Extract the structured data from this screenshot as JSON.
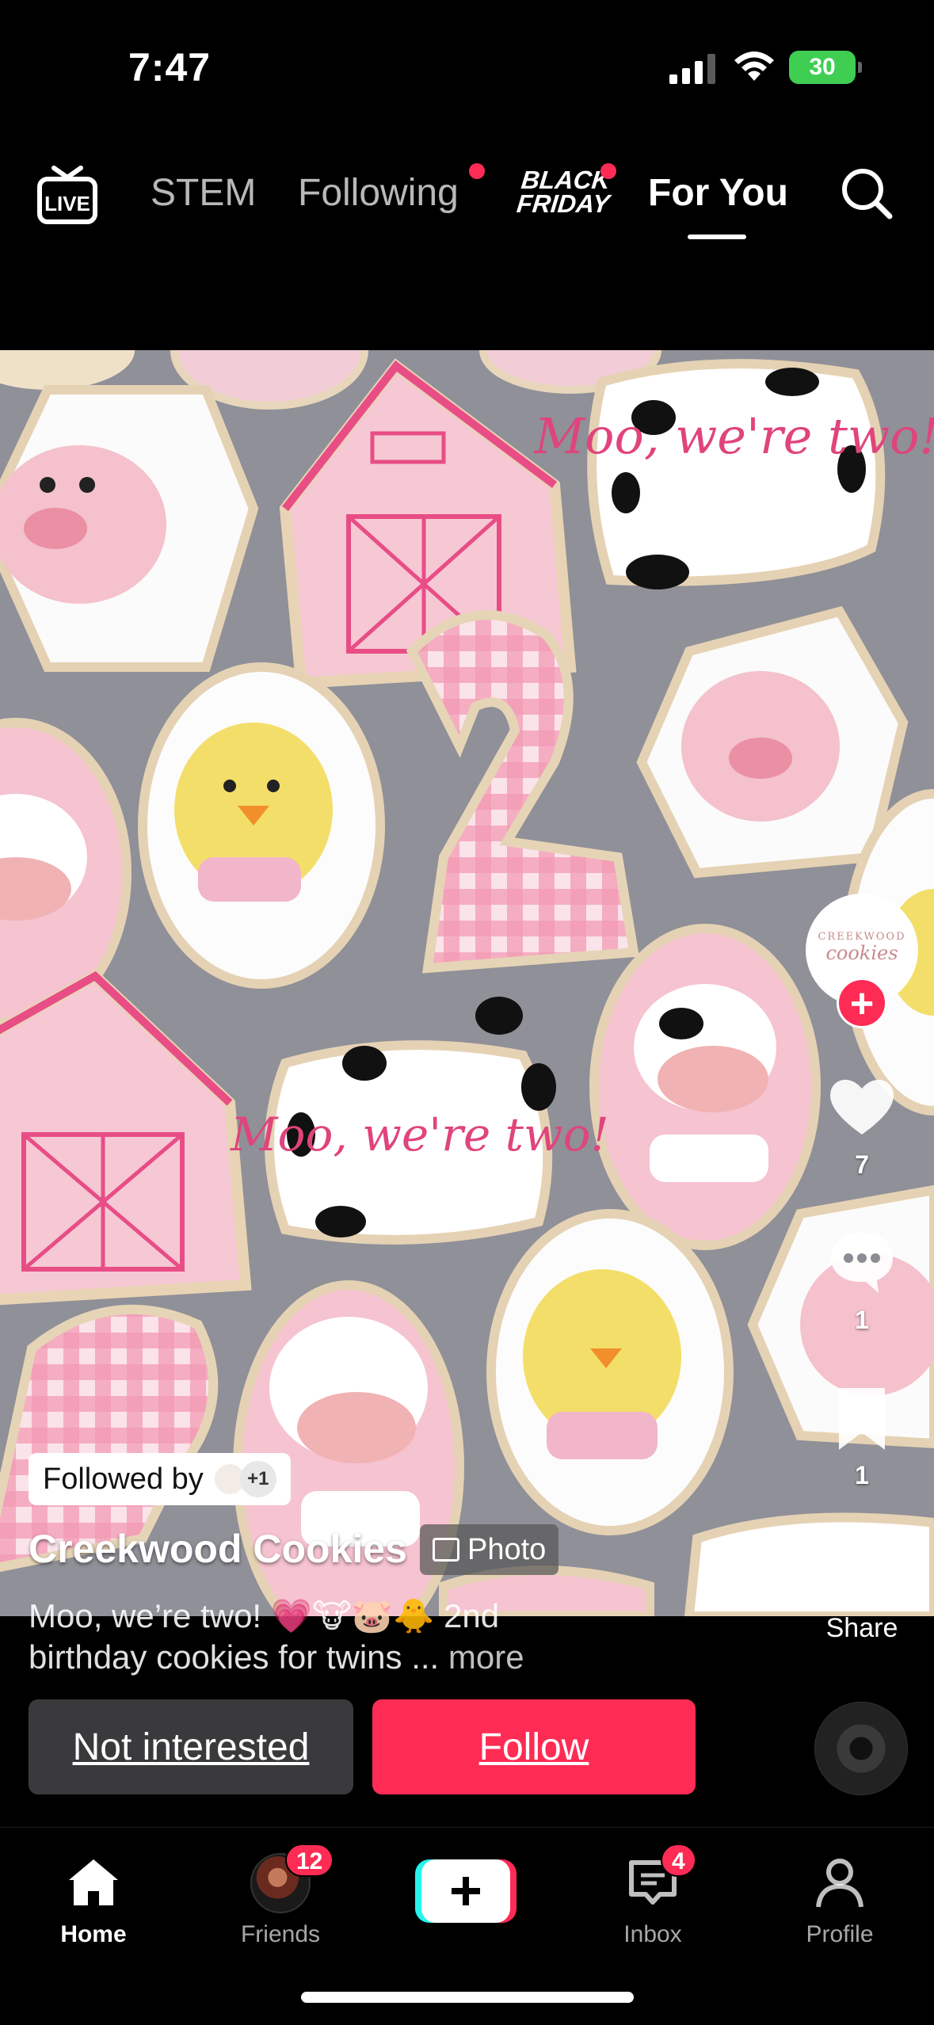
{
  "status_bar": {
    "time": "7:47",
    "battery": "30"
  },
  "top_nav": {
    "live_label": "LIVE",
    "tabs": [
      {
        "label": "STEM"
      },
      {
        "label": "Following"
      },
      {
        "label": "BLACK FRIDAY"
      },
      {
        "label": "For You"
      }
    ],
    "active_tab": "For You",
    "accent_color": "#fe2c55"
  },
  "post": {
    "followed_by_label": "Followed by",
    "followed_by_extra": "+1",
    "account_name": "Creekwood Cookies",
    "media_type_label": "Photo",
    "caption_line1": "Moo, we’re two! 💗🐮🐷🐥 2nd",
    "caption_line2": "birthday cookies for twins ...",
    "more_label": "more",
    "avatar_logo_top": "CREEKWOOD",
    "avatar_logo_script": "cookies",
    "cookie_text_1": "Moo, we're two!",
    "cookie_text_2": "Moo, we're two!"
  },
  "rail": {
    "likes": "7",
    "comments": "1",
    "saves": "1",
    "share_label": "Share"
  },
  "actions": {
    "not_interested": "Not interested",
    "follow": "Follow"
  },
  "bottom_nav": {
    "home": "Home",
    "friends": "Friends",
    "friends_badge": "12",
    "inbox": "Inbox",
    "inbox_badge": "4",
    "profile": "Profile"
  }
}
